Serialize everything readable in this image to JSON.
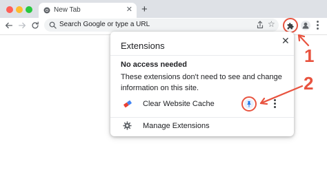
{
  "tab": {
    "title": "New Tab",
    "close": "✕",
    "new_tab": "+"
  },
  "toolbar": {
    "omnibox_placeholder": "Search Google or type a URL",
    "star": "☆"
  },
  "popup": {
    "title": "Extensions",
    "close": "✕",
    "section_heading": "No access needed",
    "section_desc": "These extensions don't need to see and change information on this site.",
    "extensions": [
      {
        "name": "Clear Website Cache",
        "icon": "eraser-icon"
      }
    ],
    "manage_label": "Manage Extensions"
  },
  "annotations": {
    "callout_1": "1",
    "callout_2": "2",
    "color": "#e8533f"
  },
  "icons": {
    "back": "arrow-left-icon",
    "forward": "arrow-right-icon",
    "reload": "reload-icon",
    "search": "search-icon",
    "share": "share-icon",
    "extensions": "puzzle-icon",
    "profile": "profile-icon",
    "menu": "kebab-menu-icon",
    "pin": "pin-icon",
    "settings": "gear-icon"
  }
}
